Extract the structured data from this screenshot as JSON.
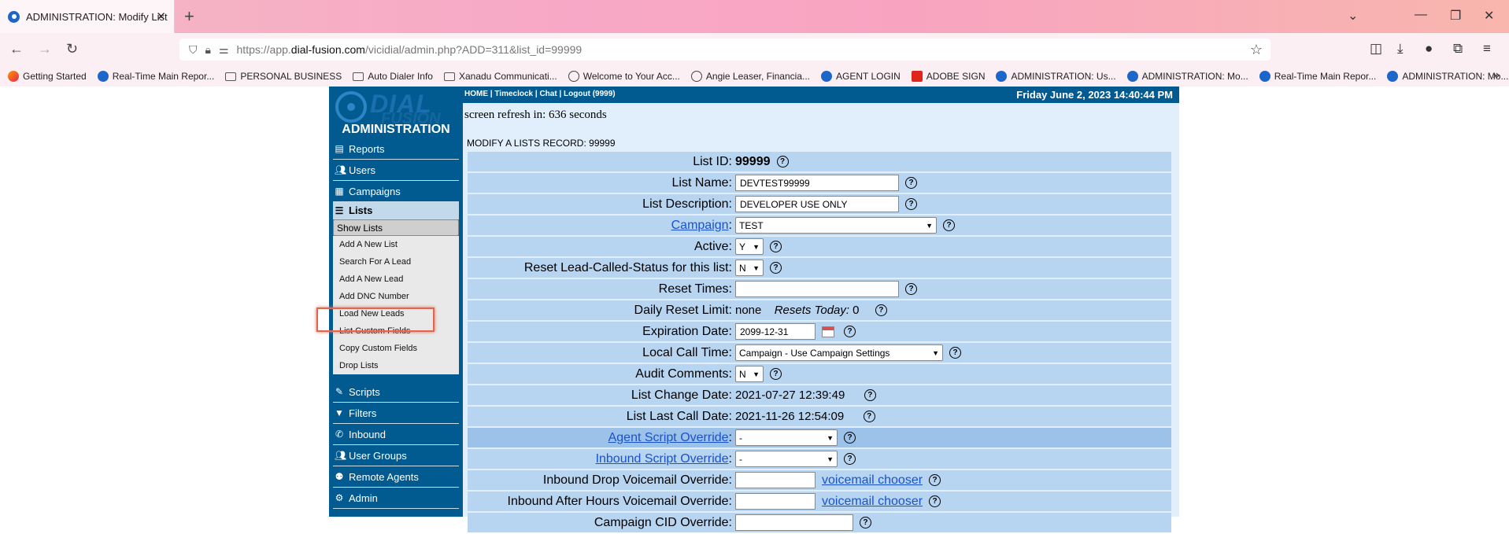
{
  "browser": {
    "tab_title": "ADMINISTRATION: Modify List",
    "url_prefix": "https://app.",
    "url_domain": "dial-fusion.com",
    "url_path": "/vicidial/admin.php?ADD=311&list_id=99999",
    "bookmarks": [
      {
        "label": "Getting Started",
        "icon": "firefox-icon"
      },
      {
        "label": "Real-Time Main Repor...",
        "icon": "dot-icon"
      },
      {
        "label": "PERSONAL BUSINESS",
        "icon": "folder-icon"
      },
      {
        "label": "Auto Dialer Info",
        "icon": "folder-icon"
      },
      {
        "label": "Xanadu Communicati...",
        "icon": "folder-icon"
      },
      {
        "label": "Welcome to Your Acc...",
        "icon": "globe-icon"
      },
      {
        "label": "Angie Leaser, Financia...",
        "icon": "globe-icon"
      },
      {
        "label": "AGENT LOGIN",
        "icon": "dot-icon"
      },
      {
        "label": "ADOBE SIGN",
        "icon": "adobe-icon"
      },
      {
        "label": "ADMINISTRATION: Us...",
        "icon": "dot-icon"
      },
      {
        "label": "ADMINISTRATION: Mo...",
        "icon": "dot-icon"
      },
      {
        "label": "Real-Time Main Repor...",
        "icon": "dot-icon"
      },
      {
        "label": "ADMINISTRATION: Mo...",
        "icon": "dot-icon"
      }
    ]
  },
  "sidebar": {
    "logo_text_1": "DIAL",
    "logo_text_2": "FUSION",
    "title": "ADMINISTRATION",
    "items_top": [
      {
        "label": "Reports",
        "icon": "chart-icon"
      },
      {
        "label": "Users",
        "icon": "users-icon"
      },
      {
        "label": "Campaigns",
        "icon": "campaigns-icon"
      }
    ],
    "lists_label": "Lists",
    "lists_sub": [
      "Show Lists",
      "Add A New List",
      "Search For A Lead",
      "Add A New Lead",
      "Add DNC Number",
      "Load New Leads",
      "List Custom Fields",
      "Copy Custom Fields",
      "Drop Lists"
    ],
    "items_bottom": [
      {
        "label": "Scripts",
        "icon": "scripts-icon"
      },
      {
        "label": "Filters",
        "icon": "filter-icon"
      },
      {
        "label": "Inbound",
        "icon": "phone-icon"
      },
      {
        "label": "User Groups",
        "icon": "users-icon"
      },
      {
        "label": "Remote Agents",
        "icon": "remote-icon"
      },
      {
        "label": "Admin",
        "icon": "gear-icon"
      }
    ]
  },
  "header": {
    "home": "HOME",
    "timeclock": "Timeclock",
    "chat": "Chat",
    "logout": "Logout (9999)",
    "sep": " | ",
    "datetime": "Friday June 2, 2023 14:40:44 PM"
  },
  "main": {
    "refresh": "screen refresh in: 636 seconds",
    "title": "MODIFY A LISTS RECORD: 99999"
  },
  "form": {
    "list_id_label": "List ID:",
    "list_id": "99999",
    "list_name_label": "List Name:",
    "list_name": "DEVTEST99999",
    "list_desc_label": "List Description:",
    "list_desc": "DEVELOPER USE ONLY",
    "campaign_label": "Campaign",
    "campaign": "TEST",
    "active_label": "Active:",
    "active": "Y",
    "reset_status_label": "Reset Lead-Called-Status for this list:",
    "reset_status": "N",
    "reset_times_label": "Reset Times:",
    "reset_times": "",
    "daily_reset_label": "Daily Reset Limit:",
    "daily_reset": "none",
    "resets_today_label": "Resets Today:",
    "resets_today": "0",
    "expiration_label": "Expiration Date:",
    "expiration": "2099-12-31",
    "local_call_time_label": "Local Call Time:",
    "local_call_time": "Campaign - Use Campaign Settings",
    "audit_label": "Audit Comments:",
    "audit": "N",
    "change_date_label": "List Change Date:",
    "change_date": "2021-07-27 12:39:49",
    "last_call_label": "List Last Call Date:",
    "last_call": "2021-11-26 12:54:09",
    "agent_script_label": "Agent Script Override",
    "agent_script": "-",
    "inbound_script_label": "Inbound Script Override",
    "inbound_script": "-",
    "inbound_drop_vm_label": "Inbound Drop Voicemail Override:",
    "inbound_after_hours_label": "Inbound After Hours Voicemail Override:",
    "vm_chooser": "voicemail chooser",
    "campaign_cid_label": "Campaign CID Override:",
    "colon": ":"
  }
}
